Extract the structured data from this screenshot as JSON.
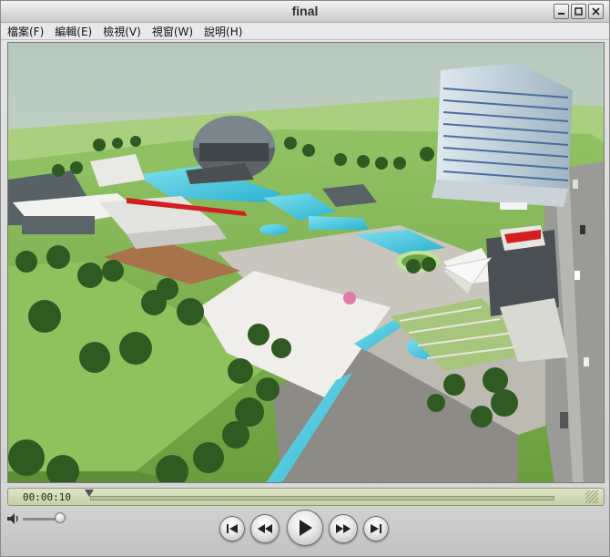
{
  "window": {
    "title": "final",
    "buttons": [
      "_",
      "□",
      "✕"
    ]
  },
  "menu": [
    {
      "label": "檔案(F)"
    },
    {
      "label": "編輯(E)"
    },
    {
      "label": "檢視(V)"
    },
    {
      "label": "視窗(W)"
    },
    {
      "label": "說明(H)"
    }
  ],
  "player": {
    "timecode": "00:00:10",
    "progress_fraction": 0.0,
    "volume_fraction": 0.9
  },
  "icons": {
    "minimize": "minimize-icon",
    "maximize": "maximize-icon",
    "close": "close-icon",
    "volume": "speaker-icon",
    "start": "skip-to-start-icon",
    "rewind": "rewind-icon",
    "play": "play-icon",
    "forward": "fast-forward-icon",
    "end": "skip-to-end-icon"
  }
}
